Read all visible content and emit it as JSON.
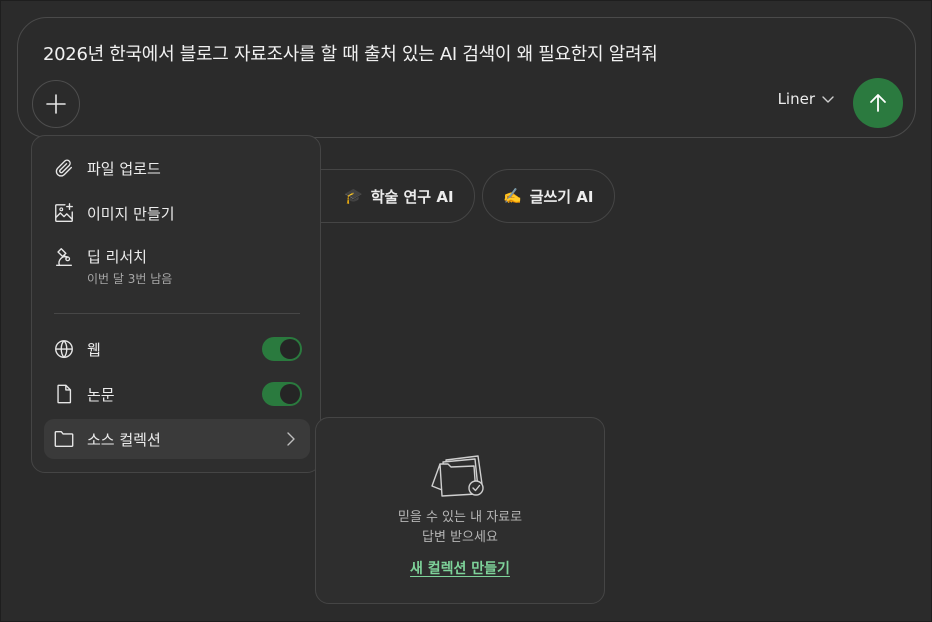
{
  "prompt": {
    "text": "2026년 한국에서 블로그 자료조사를 할 때 출처 있는 AI 검색이 왜 필요한지 알려줘",
    "model_label": "Liner"
  },
  "chips": [
    {
      "emoji": "🎓",
      "label": "학술 연구 AI"
    },
    {
      "emoji": "✍️",
      "label": "글쓰기 AI"
    }
  ],
  "menu": {
    "upload": "파일 업로드",
    "image": "이미지 만들기",
    "deep_research": "딥 리서치",
    "deep_research_sub": "이번 달 3번 남음",
    "web": "웹",
    "paper": "논문",
    "collection": "소스 컬렉션",
    "web_on": true,
    "paper_on": true
  },
  "popover": {
    "line1": "믿을 수 있는 내 자료로",
    "line2": "답변 받으세요",
    "cta": "새 컬렉션 만들기"
  },
  "colors": {
    "accent": "#2b7a3f",
    "link": "#7ed39a",
    "background": "#2b2b2b"
  }
}
